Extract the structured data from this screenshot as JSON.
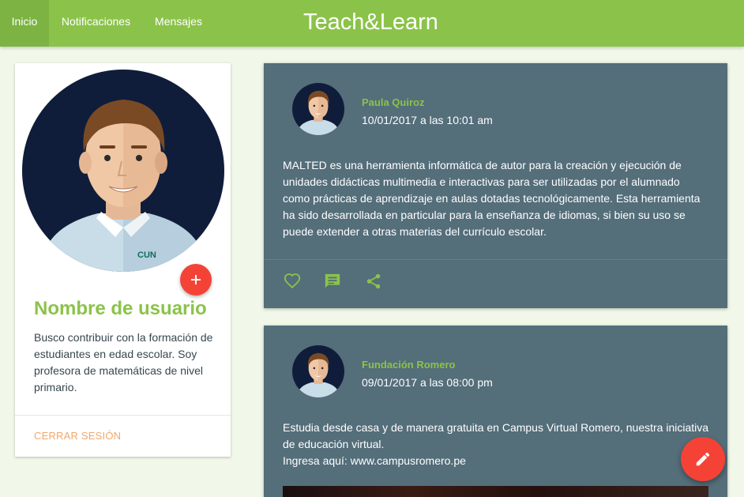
{
  "nav": {
    "items": [
      {
        "label": "Inicio",
        "active": true
      },
      {
        "label": "Notificaciones",
        "active": false
      },
      {
        "label": "Mensajes",
        "active": false
      }
    ],
    "brand": "Teach&Learn"
  },
  "profile": {
    "name": "Nombre de usuario",
    "bio": "Busco contribuir con la formación de estudiantes en edad escolar. Soy profesora de matemáticas de nivel primario.",
    "logout_label": "CERRAR SESIÓN",
    "shirt_logo_text": "CUN",
    "add_icon": "plus-icon"
  },
  "posts": [
    {
      "author": "Paula Quiroz",
      "date": "10/01/2017 a las 10:01 am",
      "body": "MALTED es una herramienta informática de autor para la creación y ejecución de unidades didácticas multimedia e interactivas para ser utilizadas por el alumnado como prácticas de aprendizaje en aulas dotadas tecnológicamente. Esta herramienta ha sido desarrollada en particular para la enseñanza de idiomas, si bien su uso se puede extender a otras materias del currículo escolar.",
      "actions": [
        "heart-icon",
        "comment-icon",
        "share-icon"
      ]
    },
    {
      "author": "Fundación Romero",
      "date": "09/01/2017 a las 08:00 pm",
      "body_line1": "Estudia desde casa y de manera gratuita en Campus Virtual Romero, nuestra iniciativa de educación virtual.",
      "body_line2": "Ingresa aquí: www.campusromero.pe"
    }
  ],
  "colors": {
    "primary": "#8bc34a",
    "primary_dark": "#7cb342",
    "card_dark": "#546e7a",
    "accent": "#f44336",
    "logout": "#f0a868",
    "background": "#f1f8e9"
  },
  "fab": {
    "icon": "pencil-icon"
  }
}
